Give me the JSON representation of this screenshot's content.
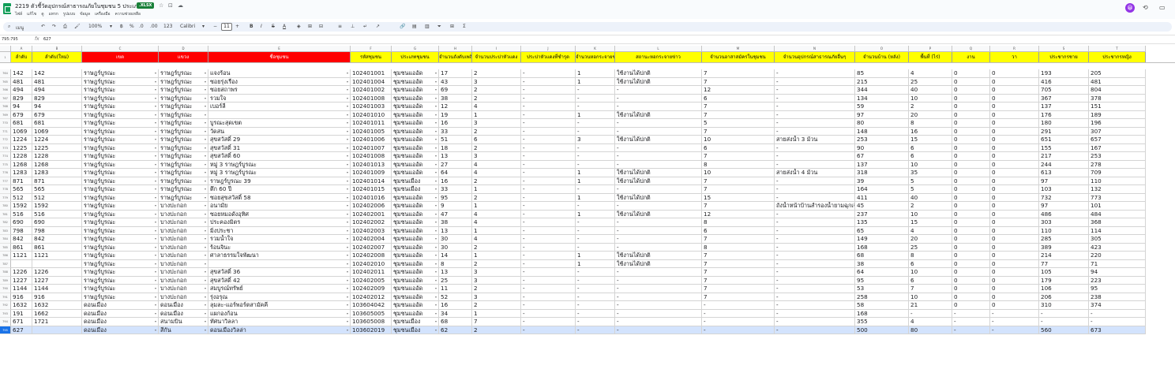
{
  "window": {
    "title": "2219 ตัวชี้วัดอุปกรณ์สาธารณภัยในชุมชน 5 ประเภท",
    "badge": ".XLSX",
    "avatar": "😀"
  },
  "menu": [
    "ไฟล์",
    "แก้ไข",
    "ดู",
    "แทรก",
    "รูปแบบ",
    "ข้อมูล",
    "เครื่องมือ",
    "ความช่วยเหลือ"
  ],
  "toolbar": {
    "search": "เมนู",
    "zoom": "100%",
    "font": "Calibri",
    "font_size": "11"
  },
  "formula": {
    "cell": "795:795",
    "fx": "fx",
    "value": "627"
  },
  "accent": "#ffff00",
  "headers": [
    {
      "label": "ลำดับ",
      "bg": "#ffff00",
      "color": "#000"
    },
    {
      "label": "ลำดับ(ใหม่)",
      "bg": "#ffff00",
      "color": "#000"
    },
    {
      "label": "เขต",
      "bg": "#ff0000",
      "color": "#fff"
    },
    {
      "label": "แขวง",
      "bg": "#ff0000",
      "color": "#fff"
    },
    {
      "label": "ชื่อชุมชน",
      "bg": "#ff0000",
      "color": "#fff"
    },
    {
      "label": "รหัสชุมชน",
      "bg": "#ffff00",
      "color": "#000"
    },
    {
      "label": "ประเภทชุมชน",
      "bg": "#ffff00",
      "color": "#000"
    },
    {
      "label": "จำนวนถังดับเพลิง",
      "bg": "#ffff00",
      "color": "#000"
    },
    {
      "label": "จำนวนประปาหัวแดง",
      "bg": "#ffff00",
      "color": "#000"
    },
    {
      "label": "ประปาหัวแดงที่ชำรุด",
      "bg": "#ffff00",
      "color": "#000"
    },
    {
      "label": "จำนวนหอกระจายข่าว",
      "bg": "#ffff00",
      "color": "#000"
    },
    {
      "label": "สถานะหอกระจายข่าว",
      "bg": "#ffff00",
      "color": "#000"
    },
    {
      "label": "จำนวนอาสาสมัครในชุมชน",
      "bg": "#ffff00",
      "color": "#000"
    },
    {
      "label": "จำนวนอุปกรณ์สาธารณภัยอื่นๆ",
      "bg": "#ffff00",
      "color": "#000"
    },
    {
      "label": "จำนวนบ้าน (หลัง)",
      "bg": "#ffff00",
      "color": "#000"
    },
    {
      "label": "พื้นที่ (ไร่)",
      "bg": "#ffff00",
      "color": "#000"
    },
    {
      "label": "งาน",
      "bg": "#ffff00",
      "color": "#000"
    },
    {
      "label": "วา",
      "bg": "#ffff00",
      "color": "#000"
    },
    {
      "label": "ประชากรชาย",
      "bg": "#ffff00",
      "color": "#000"
    },
    {
      "label": "ประชากรหญิง",
      "bg": "#ffff00",
      "color": "#000"
    }
  ],
  "rows": [
    [
      "142",
      "142",
      "ราษฎร์บูรณะ",
      "ราษฎร์บูรณะ",
      "แจงร้อน",
      "102401001",
      "ชุมชนแออัด",
      "17",
      "2",
      "-",
      "1",
      "ใช้งานได้ปกติ",
      "7",
      "-",
      "85",
      "4",
      "0",
      "0",
      "193",
      "205"
    ],
    [
      "481",
      "481",
      "ราษฎร์บูรณะ",
      "ราษฎร์บูรณะ",
      "ซอยรุ่งเรือง",
      "102401004",
      "ชุมชนแออัด",
      "43",
      "3",
      "-",
      "1",
      "ใช้งานได้ปกติ",
      "7",
      "-",
      "215",
      "25",
      "0",
      "0",
      "416",
      "481"
    ],
    [
      "494",
      "494",
      "ราษฎร์บูรณะ",
      "ราษฎร์บูรณะ",
      "ซอยสถาพร",
      "102401002",
      "ชุมชนแออัด",
      "69",
      "2",
      "-",
      "-",
      "-",
      "12",
      "-",
      "344",
      "40",
      "0",
      "0",
      "705",
      "804"
    ],
    [
      "829",
      "829",
      "ราษฎร์บูรณะ",
      "ราษฎร์บูรณะ",
      "รวมใจ",
      "102401008",
      "ชุมชนแออัด",
      "38",
      "2",
      "-",
      "-",
      "-",
      "6",
      "-",
      "134",
      "10",
      "0",
      "0",
      "367",
      "378"
    ],
    [
      "94",
      "94",
      "ราษฎร์บูรณะ",
      "ราษฎร์บูรณะ",
      "เบอร์ลี",
      "102401003",
      "ชุมชนแออัด",
      "12",
      "4",
      "-",
      "-",
      "-",
      "7",
      "-",
      "59",
      "2",
      "0",
      "0",
      "137",
      "151"
    ],
    [
      "679",
      "679",
      "ราษฎร์บูรณะ",
      "ราษฎร์บูรณะ",
      "",
      "102401010",
      "ชุมชนแออัด",
      "19",
      "1",
      "-",
      "1",
      "ใช้งานได้ปกติ",
      "7",
      "-",
      "97",
      "20",
      "0",
      "0",
      "176",
      "189"
    ],
    [
      "681",
      "681",
      "ราษฎร์บูรณะ",
      "ราษฎร์บูรณะ",
      "บูรณะสุดเขต",
      "102401011",
      "ชุมชนแออัด",
      "16",
      "3",
      "-",
      "-",
      "-",
      "5",
      "-",
      "80",
      "8",
      "0",
      "0",
      "180",
      "196"
    ],
    [
      "1069",
      "1069",
      "ราษฎร์บูรณะ",
      "ราษฎร์บูรณะ",
      "วัดสน",
      "102401005",
      "ชุมชนแออัด",
      "33",
      "2",
      "-",
      "-",
      "-",
      "7",
      "-",
      "148",
      "16",
      "0",
      "0",
      "291",
      "307"
    ],
    [
      "1224",
      "1224",
      "ราษฎร์บูรณะ",
      "ราษฎร์บูรณะ",
      "สุขสวัสดิ์ 29",
      "102401006",
      "ชุมชนแออัด",
      "51",
      "6",
      "-",
      "3",
      "ใช้งานได้ปกติ",
      "10",
      "สายส่งน้ำ 3 ม้วน",
      "253",
      "15",
      "0",
      "0",
      "651",
      "657"
    ],
    [
      "1225",
      "1225",
      "ราษฎร์บูรณะ",
      "ราษฎร์บูรณะ",
      "สุขสวัสดิ์ 31",
      "102401007",
      "ชุมชนแออัด",
      "18",
      "2",
      "-",
      "-",
      "-",
      "6",
      "-",
      "90",
      "6",
      "0",
      "0",
      "155",
      "167"
    ],
    [
      "1228",
      "1228",
      "ราษฎร์บูรณะ",
      "ราษฎร์บูรณะ",
      "สุขสวัสดิ์ 60",
      "102401008",
      "ชุมชนแออัด",
      "13",
      "3",
      "-",
      "-",
      "-",
      "7",
      "-",
      "67",
      "6",
      "0",
      "0",
      "217",
      "253"
    ],
    [
      "1268",
      "1268",
      "ราษฎร์บูรณะ",
      "ราษฎร์บูรณะ",
      "หมู่ 3 ราษฎร์บูรณะ",
      "102401013",
      "ชุมชนแออัด",
      "27",
      "4",
      "-",
      "-",
      "-",
      "8",
      "-",
      "137",
      "10",
      "0",
      "0",
      "244",
      "278"
    ],
    [
      "1283",
      "1283",
      "ราษฎร์บูรณะ",
      "ราษฎร์บูรณะ",
      "หมู่ 3 ราษฎร์บูรณะ",
      "102401009",
      "ชุมชนแออัด",
      "64",
      "4",
      "-",
      "1",
      "ใช้งานได้ปกติ",
      "10",
      "สายส่งน้ำ 4 ม้วน",
      "318",
      "35",
      "0",
      "0",
      "613",
      "709"
    ],
    [
      "871",
      "871",
      "ราษฎร์บูรณะ",
      "ราษฎร์บูรณะ",
      "ราษฎร์บูรณะ 39",
      "102401014",
      "ชุมชนเมือง",
      "16",
      "2",
      "-",
      "1",
      "ใช้งานได้ปกติ",
      "7",
      "-",
      "39",
      "5",
      "0",
      "0",
      "97",
      "110"
    ],
    [
      "565",
      "565",
      "ราษฎร์บูรณะ",
      "ราษฎร์บูรณะ",
      "ตึก 60 ปี",
      "102401015",
      "ชุมชนเมือง",
      "33",
      "1",
      "-",
      "-",
      "-",
      "7",
      "-",
      "164",
      "5",
      "0",
      "0",
      "103",
      "132"
    ],
    [
      "512",
      "512",
      "ราษฎร์บูรณะ",
      "ราษฎร์บูรณะ",
      "ซอยสุขสวัสดิ์ 58",
      "102401016",
      "ชุมชนแออัด",
      "95",
      "2",
      "-",
      "1",
      "ใช้งานได้ปกติ",
      "15",
      "-",
      "411",
      "40",
      "0",
      "0",
      "732",
      "773"
    ],
    [
      "1592",
      "1592",
      "ราษฎร์บูรณะ",
      "บางปะกอก",
      "อนามัย",
      "102402006",
      "ชุมชนแออัด",
      "9",
      "1",
      "-",
      "-",
      "-",
      "7",
      "ถังน้ำหน้าบ้านสำรองน้ำยามฉุกเฉิน",
      "45",
      "2",
      "0",
      "0",
      "97",
      "101"
    ],
    [
      "516",
      "516",
      "ราษฎร์บูรณะ",
      "บางปะกอก",
      "ซอยหมอดังอุทิศ",
      "102402001",
      "ชุมชนแออัด",
      "47",
      "4",
      "-",
      "1",
      "ใช้งานได้ปกติ",
      "12",
      "-",
      "237",
      "10",
      "0",
      "0",
      "486",
      "484"
    ],
    [
      "690",
      "690",
      "ราษฎร์บูรณะ",
      "บางปะกอก",
      "ประคองมิตร",
      "102402002",
      "ชุมชนแออัด",
      "38",
      "4",
      "-",
      "-",
      "-",
      "8",
      "-",
      "135",
      "15",
      "0",
      "0",
      "303",
      "368"
    ],
    [
      "798",
      "798",
      "ราษฎร์บูรณะ",
      "บางปะกอก",
      "มิ่งประชา",
      "102402003",
      "ชุมชนแออัด",
      "13",
      "1",
      "-",
      "-",
      "-",
      "6",
      "-",
      "65",
      "4",
      "0",
      "0",
      "110",
      "114"
    ],
    [
      "842",
      "842",
      "ราษฎร์บูรณะ",
      "บางปะกอก",
      "รวมน้ำใจ",
      "102402004",
      "ชุมชนแออัด",
      "30",
      "4",
      "-",
      "-",
      "-",
      "7",
      "-",
      "149",
      "20",
      "0",
      "0",
      "285",
      "305"
    ],
    [
      "861",
      "861",
      "ราษฎร์บูรณะ",
      "บางปะกอก",
      "ร้อนจินะ",
      "102402007",
      "ชุมชนแออัด",
      "30",
      "2",
      "-",
      "-",
      "-",
      "8",
      "-",
      "168",
      "25",
      "0",
      "0",
      "389",
      "423"
    ],
    [
      "1121",
      "1121",
      "ราษฎร์บูรณะ",
      "บางปะกอก",
      "ศาลาธรรมใจพัฒนา",
      "102402008",
      "ชุมชนแออัด",
      "14",
      "1",
      "-",
      "1",
      "ใช้งานได้ปกติ",
      "7",
      "-",
      "68",
      "8",
      "0",
      "0",
      "214",
      "220"
    ],
    [
      "",
      "",
      "ราษฎร์บูรณะ",
      "บางปะกอก",
      "",
      "102402010",
      "ชุมชนแออัด",
      "8",
      "2",
      "-",
      "1",
      "ใช้งานได้ปกติ",
      "7",
      "-",
      "38",
      "6",
      "0",
      "0",
      "77",
      "71"
    ],
    [
      "1226",
      "1226",
      "ราษฎร์บูรณะ",
      "บางปะกอก",
      "สุขสวัสดิ์ 36",
      "102402011",
      "ชุมชนแออัด",
      "13",
      "3",
      "-",
      "-",
      "-",
      "7",
      "-",
      "64",
      "10",
      "0",
      "0",
      "105",
      "94"
    ],
    [
      "1227",
      "1227",
      "ราษฎร์บูรณะ",
      "บางปะกอก",
      "สุขสวัสดิ์ 42",
      "102402005",
      "ชุมชนแออัด",
      "25",
      "3",
      "-",
      "-",
      "-",
      "7",
      "-",
      "95",
      "6",
      "0",
      "0",
      "179",
      "223"
    ],
    [
      "1144",
      "1144",
      "ราษฎร์บูรณะ",
      "บางปะกอก",
      "สมบูรณ์ทรัพย์",
      "102402009",
      "ชุมชนแออัด",
      "11",
      "2",
      "-",
      "-",
      "-",
      "7",
      "-",
      "53",
      "7",
      "0",
      "0",
      "106",
      "95"
    ],
    [
      "916",
      "916",
      "ราษฎร์บูรณะ",
      "บางปะกอก",
      "รุ่งอรุณ",
      "102402012",
      "ชุมชนแออัด",
      "52",
      "3",
      "-",
      "-",
      "-",
      "7",
      "-",
      "258",
      "10",
      "0",
      "0",
      "206",
      "238"
    ],
    [
      "1632",
      "1632",
      "ดอนเมือง",
      "ดอนเมือง",
      "ลุมละ-แอร์พอร์ตสามัคคี",
      "103604042",
      "ชุมชนแออัด",
      "16",
      "2",
      "-",
      "-",
      "-",
      "-",
      "-",
      "58",
      "21",
      "0",
      "0",
      "310",
      "374"
    ],
    [
      "191",
      "1662",
      "ดอนเมือง",
      "ดอนเมือง",
      "แผกองก้อน",
      "103605005",
      "ชุมชนแออัด",
      "34",
      "1",
      "-",
      "-",
      "-",
      "-",
      "-",
      "168",
      "-",
      "-",
      "-",
      "-",
      "-"
    ],
    [
      "671",
      "1721",
      "ดอนเมือง",
      "สนามบิน",
      "ทัศนาวิลลา",
      "103605008",
      "ชุมชนเมือง",
      "68",
      "7",
      "-",
      "-",
      "-",
      "-",
      "-",
      "355",
      "4",
      "-",
      "-",
      "-",
      "-"
    ],
    [
      "627",
      "",
      "ดอนเมือง",
      "สีกัน",
      "ดอนเมืองวิลล่า",
      "103602019",
      "ชุมชนเมือง",
      "62",
      "2",
      "-",
      "-",
      "-",
      "-",
      "-",
      "500",
      "80",
      "-",
      "-",
      "560",
      "673"
    ]
  ]
}
